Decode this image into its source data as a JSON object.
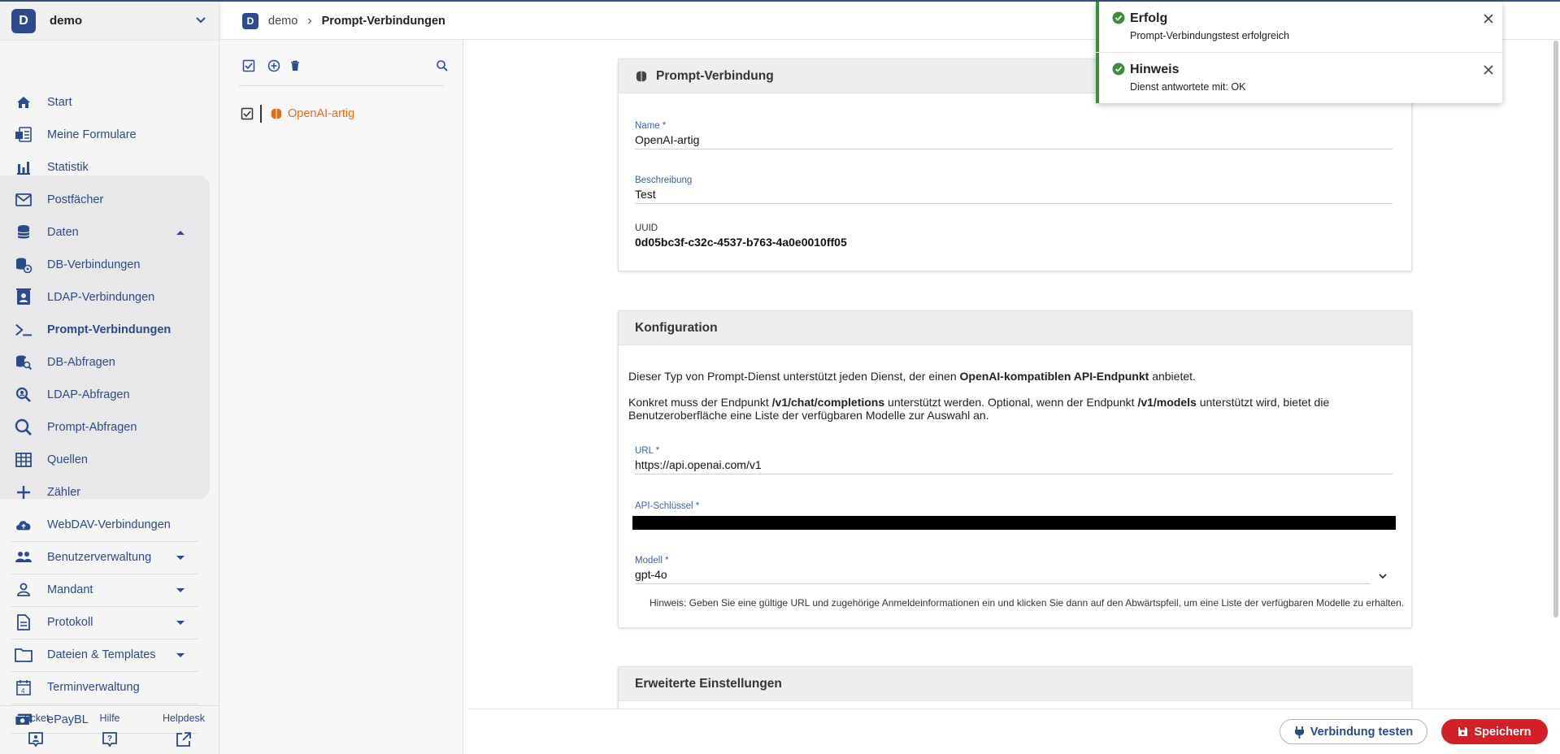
{
  "tenant": {
    "initial": "D",
    "name": "demo"
  },
  "nav": [
    {
      "label": "Start",
      "icon": "home-icon"
    },
    {
      "label": "Meine Formulare",
      "icon": "forms-icon"
    },
    {
      "label": "Statistik",
      "icon": "bar-chart-icon"
    },
    {
      "label": "Postfächer",
      "icon": "mail-icon"
    },
    {
      "label": "Daten",
      "icon": "database-icon"
    },
    {
      "label": "DB-Verbindungen",
      "icon": "db-connection-icon"
    },
    {
      "label": "LDAP-Verbindungen",
      "icon": "ldap-icon"
    },
    {
      "label": "Prompt-Verbindungen",
      "icon": "terminal-icon"
    },
    {
      "label": "DB-Abfragen",
      "icon": "db-query-icon"
    },
    {
      "label": "LDAP-Abfragen",
      "icon": "ldap-query-icon"
    },
    {
      "label": "Prompt-Abfragen",
      "icon": "search-icon"
    },
    {
      "label": "Quellen",
      "icon": "table-icon"
    },
    {
      "label": "Zähler",
      "icon": "plus-icon"
    },
    {
      "label": "WebDAV-Verbindungen",
      "icon": "cloud-upload-icon"
    },
    {
      "label": "Benutzerverwaltung",
      "icon": "users-icon"
    },
    {
      "label": "Mandant",
      "icon": "person-icon"
    },
    {
      "label": "Protokoll",
      "icon": "document-icon"
    },
    {
      "label": "Dateien & Templates",
      "icon": "folder-icon"
    },
    {
      "label": "Terminverwaltung",
      "icon": "calendar-icon"
    },
    {
      "label": "ePayBL",
      "icon": "money-icon"
    }
  ],
  "footer": {
    "ticket": "Ticket",
    "hilfe": "Hilfe",
    "helpdesk": "Helpdesk"
  },
  "breadcrumb": {
    "initial": "D",
    "root": "demo",
    "current": "Prompt-Verbindungen"
  },
  "list": {
    "item_label": "OpenAI-artig"
  },
  "card1": {
    "title": "Prompt-Verbindung",
    "name_label": "Name *",
    "name_value": "OpenAI-artig",
    "desc_label": "Beschreibung",
    "desc_value": "Test",
    "uuid_label": "UUID",
    "uuid_value": "0d05bc3f-c32c-4537-b763-4a0e0010ff05"
  },
  "card2": {
    "title": "Konfiguration",
    "p1_a": "Dieser Typ von Prompt-Dienst unterstützt jeden Dienst, der einen ",
    "p1_b": "OpenAI-kompatiblen API-Endpunkt",
    "p1_c": " anbietet.",
    "p2_a": "Konkret muss der Endpunkt ",
    "p2_b": "/v1/chat/completions",
    "p2_c": " unterstützt werden. Optional, wenn der Endpunkt ",
    "p2_d": "/v1/models",
    "p2_e": " unterstützt wird, bietet die",
    "p2_f": "Benutzeroberfläche eine Liste der verfügbaren Modelle zur Auswahl an.",
    "url_label": "URL *",
    "url_value": "https://api.openai.com/v1",
    "key_label": "API-Schlüssel *",
    "model_label": "Modell *",
    "model_value": "gpt-4o",
    "hint": "Hinweis: Geben Sie eine gültige URL und zugehörige Anmeldeinformationen ein und klicken Sie dann auf den Abwärtspfeil, um eine Liste der verfügbaren Modelle zu erhalten."
  },
  "card3": {
    "title": "Erweiterte Einstellungen"
  },
  "actions": {
    "test": "Verbindung testen",
    "save": "Speichern"
  },
  "toasts": [
    {
      "title": "Erfolg",
      "message": "Prompt-Verbindungstest erfolgreich"
    },
    {
      "title": "Hinweis",
      "message": "Dienst antwortete mit: OK"
    }
  ],
  "colors": {
    "brand": "#2e4a8a",
    "link": "#2c4a86",
    "accent_orange": "#e86c16",
    "danger": "#d32027",
    "success": "#3b8c3b"
  }
}
